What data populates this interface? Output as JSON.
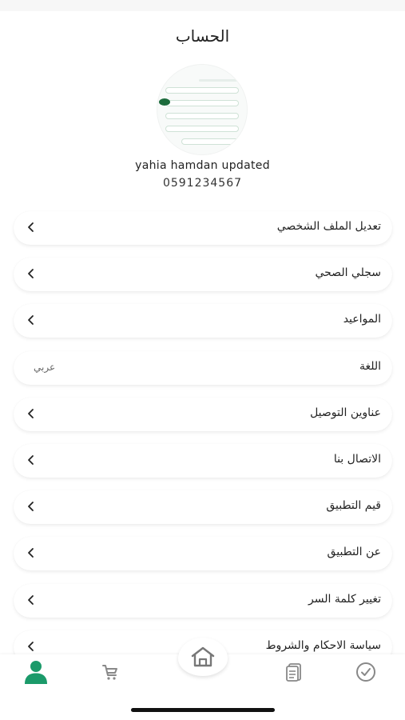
{
  "header": {
    "title": "الحساب"
  },
  "profile": {
    "name": "yahia hamdan updated",
    "phone": "0591234567"
  },
  "menu": [
    {
      "label": "تعديل الملف الشخصي",
      "type": "link"
    },
    {
      "label": "سجلي الصحي",
      "type": "link"
    },
    {
      "label": "المواعيد",
      "type": "link"
    },
    {
      "label": "اللغة",
      "type": "value",
      "value": "عربي"
    },
    {
      "label": "عناوين التوصيل",
      "type": "link"
    },
    {
      "label": "الاتصال بنا",
      "type": "link"
    },
    {
      "label": "قيم التطبيق",
      "type": "link"
    },
    {
      "label": "عن التطبيق",
      "type": "link"
    },
    {
      "label": "تغيير كلمة السر",
      "type": "link"
    },
    {
      "label": "سياسة الاحكام والشروط",
      "type": "link"
    }
  ],
  "bottom_nav": {
    "active": "account",
    "items": [
      "account-icon",
      "cart-icon",
      "home-icon",
      "clipboard-icon",
      "check-circle-icon"
    ],
    "accent": "#1b9a6a"
  }
}
